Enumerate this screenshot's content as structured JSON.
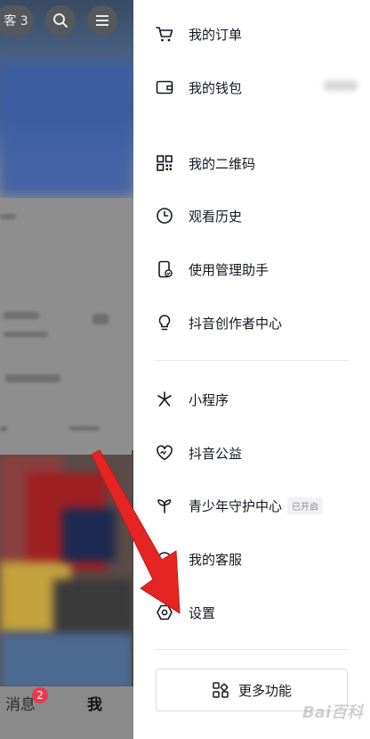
{
  "background": {
    "top_pill_text": "客 3",
    "nav_messages": "消息",
    "nav_messages_badge": "2",
    "nav_me": "我"
  },
  "drawer": {
    "items": [
      {
        "label": "我的订单",
        "icon": "cart-icon"
      },
      {
        "label": "我的钱包",
        "icon": "wallet-icon"
      },
      {
        "label": "我的二维码",
        "icon": "qrcode-icon"
      },
      {
        "label": "观看历史",
        "icon": "clock-icon"
      },
      {
        "label": "使用管理助手",
        "icon": "phone-check-icon"
      },
      {
        "label": "抖音创作者中心",
        "icon": "lightbulb-icon"
      },
      {
        "label": "小程序",
        "icon": "miniprogram-icon"
      },
      {
        "label": "抖音公益",
        "icon": "heart-icon"
      },
      {
        "label": "青少年守护中心",
        "icon": "sprout-icon",
        "tag": "已开启"
      },
      {
        "label": "我的客服",
        "icon": "headset-icon"
      },
      {
        "label": "设置",
        "icon": "hexagon-gear-icon"
      }
    ],
    "more_label": "更多功能"
  },
  "colors": {
    "arrow": "#e52424",
    "badge": "#e83a4b",
    "text": "#161823"
  }
}
